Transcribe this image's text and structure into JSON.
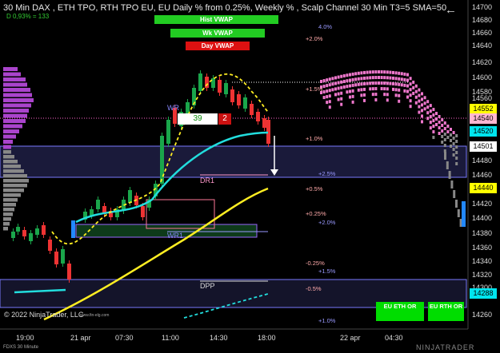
{
  "header": {
    "title": "30 Min DAX , ETH TPO, RTH TPO EU, EU Daily % from 0.25%, Weekly % , Scalp Channel 30 Min  T3=5  SMA=50",
    "sub": "D 0,93% = 133"
  },
  "vwap_buttons": [
    {
      "label": "Hist VWAP",
      "color": "#22cc22"
    },
    {
      "label": "Wk VWAP",
      "color": "#22cc22"
    },
    {
      "label": "Day VWAP",
      "color": "#dd1111"
    }
  ],
  "y_axis": {
    "ticks": [
      14700,
      14680,
      14660,
      14640,
      14620,
      14600,
      14580,
      14560,
      14480,
      14460,
      14420,
      14400,
      14380,
      14360,
      14340,
      14320,
      14300,
      14260
    ],
    "badges": [
      {
        "value": "14552",
        "color": "#ffff00"
      },
      {
        "value": "14540",
        "color": "#ffb6d0"
      },
      {
        "value": "14520",
        "color": "#00e5ee"
      },
      {
        "value": "14501",
        "color": "#ffffff"
      },
      {
        "value": "14440",
        "color": "#ffff00"
      },
      {
        "value": "14288",
        "color": "#00e5ee"
      }
    ]
  },
  "x_axis": {
    "labels": [
      "19:00",
      "21 apr",
      "07:30",
      "11:00",
      "14:30",
      "18:00",
      "22 apr",
      "04:30"
    ]
  },
  "percent_labels": [
    {
      "text": "4.0%",
      "color": "#9999ff"
    },
    {
      "text": "+2.0%",
      "color": "#ffaaaa"
    },
    {
      "text": "+1.5%",
      "color": "#ffaaaa"
    },
    {
      "text": "+1.0%",
      "color": "#ffaaaa"
    },
    {
      "text": "+2.5%",
      "color": "#9999ff"
    },
    {
      "text": "+0.5%",
      "color": "#ffaaaa"
    },
    {
      "text": "+0.25%",
      "color": "#ffaaaa"
    },
    {
      "text": "+2.0%",
      "color": "#9999ff"
    },
    {
      "text": "-0.25%",
      "color": "#ffaaaa"
    },
    {
      "text": "+1.5%",
      "color": "#9999ff"
    },
    {
      "text": "-0.5%",
      "color": "#ffaaaa"
    },
    {
      "text": "+1.0%",
      "color": "#9999ff"
    }
  ],
  "levels": {
    "wr": "WR",
    "dr1": "DR1",
    "wr1": "WR1",
    "dpp": "DPP"
  },
  "counter": {
    "left": "39",
    "right": "2"
  },
  "rth_buttons": [
    "EU ETH OR",
    "EU RTH OR"
  ],
  "copyright": "© 2022 NinjaTrader, LLC",
  "footer": "FDXS 30 Minute",
  "brand": "NINJATRADER",
  "url": "www.fin-elg.com"
}
